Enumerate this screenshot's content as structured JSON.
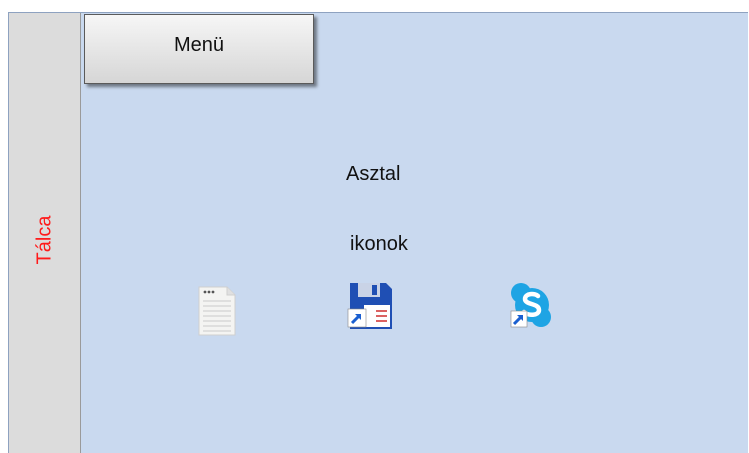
{
  "taskbar": {
    "label": "Tálca",
    "label_color": "#ff1a1a"
  },
  "menu": {
    "label": "Menü"
  },
  "desktop": {
    "title": "Asztal",
    "subtitle": "ikonok",
    "background": "#c9d9ef",
    "icons": [
      {
        "icon": "notepad-document-icon"
      },
      {
        "icon": "floppy-save-shortcut-icon"
      },
      {
        "icon": "skype-shortcut-icon"
      }
    ]
  }
}
